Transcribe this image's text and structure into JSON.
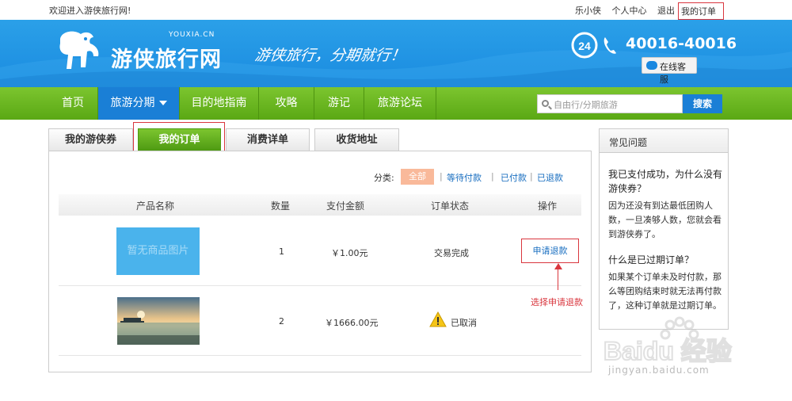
{
  "topbar": {
    "welcome": "欢迎进入游侠旅行网!",
    "user": "乐小侠",
    "personal_center": "个人中心",
    "logout": "退出",
    "my_orders": "我的订单"
  },
  "header": {
    "logo_text": "游侠旅行网",
    "logo_sub": "YOUXIA.CN",
    "slogan": "游侠旅行，分期就行！",
    "phone": "40016-40016",
    "online_service": "在线客服"
  },
  "nav": {
    "items": [
      {
        "label": "首页"
      },
      {
        "label": "旅游分期"
      },
      {
        "label": "目的地指南"
      },
      {
        "label": "攻略"
      },
      {
        "label": "游记"
      },
      {
        "label": "旅游论坛"
      }
    ],
    "search_placeholder": "自由行/分期旅游",
    "search_button": "搜索"
  },
  "tabs": [
    {
      "label": "我的游侠券"
    },
    {
      "label": "我的订单"
    },
    {
      "label": "消费详单"
    },
    {
      "label": "收货地址"
    }
  ],
  "filter": {
    "label": "分类:",
    "options": [
      "全部",
      "等待付款",
      "已付款",
      "已退款"
    ]
  },
  "table": {
    "headers": [
      "产品名称",
      "数量",
      "支付金额",
      "订单状态",
      "操作"
    ],
    "rows": [
      {
        "image_text": "暂无商品图片",
        "quantity": "1",
        "amount": "￥1.00元",
        "status": "交易完成",
        "action": "申请退款"
      },
      {
        "image_text": "",
        "quantity": "2",
        "amount": "￥1666.00元",
        "status": "已取消",
        "action": ""
      }
    ]
  },
  "annotation": "选择申请退款",
  "faq": {
    "title": "常见问题",
    "items": [
      {
        "q": "我已支付成功，为什么没有游侠券？",
        "a": "因为还没有到达最低团购人数，一旦凑够人数，您就会看到游侠券了。"
      },
      {
        "q": "什么是已过期订单？",
        "a": "如果某个订单未及时付款，那么等团购结束时就无法再付款了，这种订单就是过期订单。"
      }
    ]
  },
  "watermark": {
    "logo": "Baidu 经验",
    "url": "jingyan.baidu.com"
  },
  "colors": {
    "brand_blue": "#1a8be0",
    "nav_green": "#5aa814",
    "highlight_red": "#d9363e",
    "filter_active": "#f9b99a"
  }
}
